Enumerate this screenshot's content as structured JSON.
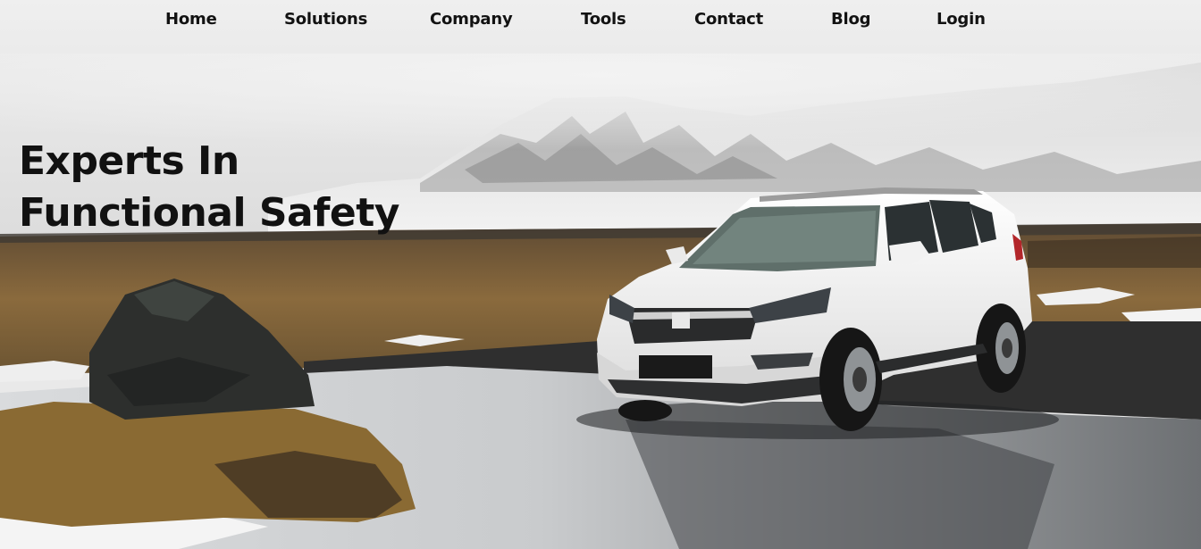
{
  "nav": {
    "items": [
      {
        "label": "Home"
      },
      {
        "label": "Solutions"
      },
      {
        "label": "Company"
      },
      {
        "label": "Tools"
      },
      {
        "label": "Contact"
      },
      {
        "label": "Blog"
      },
      {
        "label": "Login"
      }
    ]
  },
  "hero": {
    "headline_line1": "Experts In",
    "headline_line2": "Functional Safety"
  }
}
